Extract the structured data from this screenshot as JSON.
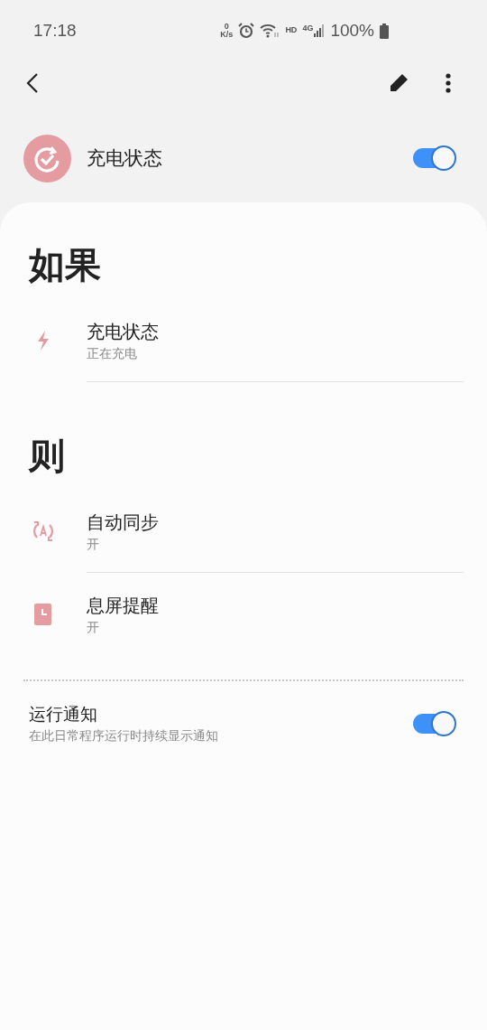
{
  "status_bar": {
    "time": "17:18",
    "speed_value": "0",
    "speed_unit": "K/s",
    "hd": "HD",
    "network": "4G",
    "battery": "100%"
  },
  "header": {
    "title": "充电状态",
    "on": true
  },
  "if_section": {
    "heading": "如果",
    "items": [
      {
        "kind": "charging",
        "title": "充电状态",
        "subtitle": "正在充电"
      }
    ]
  },
  "then_section": {
    "heading": "则",
    "items": [
      {
        "kind": "sync",
        "title": "自动同步",
        "subtitle": "开"
      },
      {
        "kind": "screen",
        "title": "息屏提醒",
        "subtitle": "开"
      }
    ]
  },
  "notification": {
    "title": "运行通知",
    "subtitle": "在此日常程序运行时持续显示通知",
    "on": true
  }
}
